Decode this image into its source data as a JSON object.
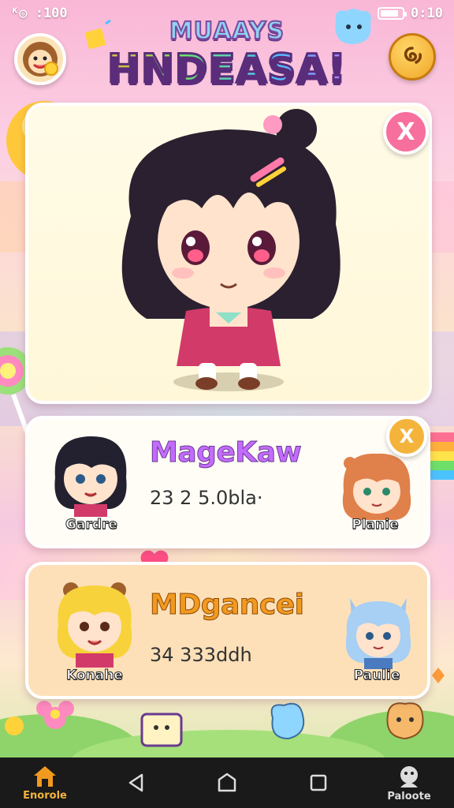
{
  "status_bar": {
    "left": "ᴷ◎ :100",
    "right": "0:10"
  },
  "header": {
    "subtitle": "MUAAYS",
    "title": "HNDEASA!"
  },
  "hero_card": {
    "close_label": "X"
  },
  "players": [
    {
      "name": "MageKaw",
      "stat": "23 2 5.0bla·",
      "left_avatar_label": "Gardre",
      "right_avatar_label": "Planie",
      "close_label": "X",
      "name_color": "#c46bff"
    },
    {
      "name": "MDgancei",
      "stat": "34 333ddh",
      "left_avatar_label": "Konahe",
      "right_avatar_label": "Paulie",
      "name_color": "#f29a1f"
    }
  ],
  "nav": {
    "home_label": "Enorole",
    "profile_label": "Paloote"
  },
  "colors": {
    "accent_pink": "#f76f9c",
    "gold_button": "#f4b43c",
    "nav_bg": "#1a1a1a"
  }
}
